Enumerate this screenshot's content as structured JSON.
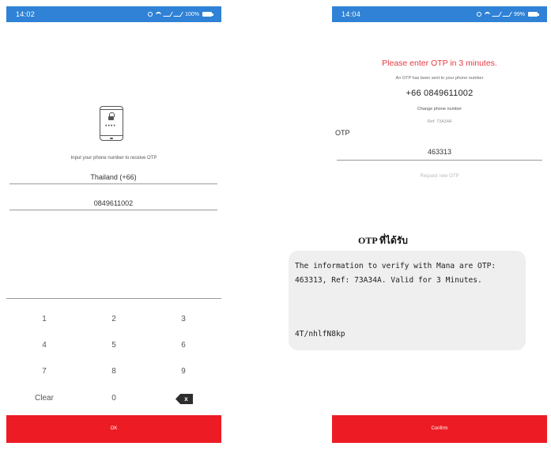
{
  "left_screen": {
    "status": {
      "time": "14:02",
      "battery": "100%"
    },
    "instruction": "Input your phone number to receive OTP",
    "country_field": "Thailand (+66)",
    "phone_field": "0849611002",
    "keypad": {
      "row1": [
        "1",
        "2",
        "3"
      ],
      "row2": [
        "4",
        "5",
        "6"
      ],
      "row3": [
        "7",
        "8",
        "9"
      ],
      "clear": "Clear",
      "zero": "0",
      "backspace": "x"
    },
    "ok_button": "OK"
  },
  "right_screen": {
    "status": {
      "time": "14:04",
      "battery": "99%"
    },
    "title": "Please enter OTP in 3 minutes.",
    "sent_message": "An OTP has been sent to your phone number",
    "phone_number": "+66 0849611002",
    "change_phone": "Change phone number",
    "ref": "Ref: 73A34A",
    "otp_label": "OTP",
    "otp_value": "463313",
    "request_new": "Request new OTP",
    "confirm_button": "Confirm"
  },
  "sms": {
    "heading": "OTP ที่ได้รับ",
    "line1": "The information to verify with Mana are OTP:",
    "line2": "463313, Ref: 73A34A. Valid for 3 Minutes.",
    "code": "4T/nhlfN8kp"
  },
  "colors": {
    "status_bar": "#2f82d6",
    "action_red": "#ed1c24",
    "title_red": "#e63a42"
  },
  "icons": [
    "phone-lock-icon",
    "backspace-icon",
    "wifi-icon",
    "signal-icon",
    "battery-icon"
  ]
}
